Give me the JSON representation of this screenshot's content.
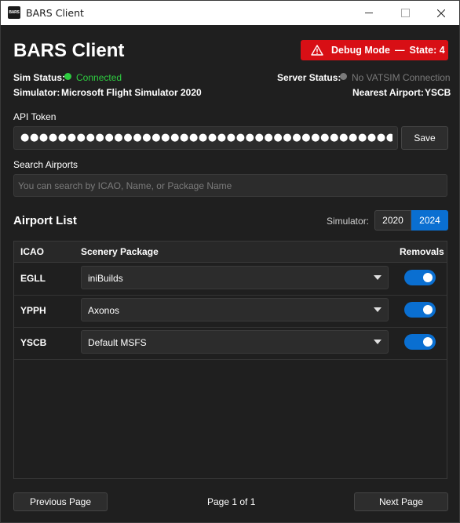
{
  "window": {
    "logo_text": "BARS",
    "title": "BARS Client"
  },
  "header": {
    "heading": "BARS Client",
    "debug": {
      "label": "Debug Mode",
      "separator": "—",
      "state": "State: 4",
      "color": "#d80f15"
    }
  },
  "status": {
    "sim_status_label": "Sim Status:",
    "sim_status_value": "Connected",
    "sim_status_color": "#2ecc40",
    "server_status_label": "Server Status:",
    "server_status_value": "No VATSIM Connection",
    "server_status_color": "#7a7a7a",
    "simulator_label": "Simulator:",
    "simulator_value": "Microsoft Flight Simulator 2020",
    "nearest_airport_label": "Nearest Airport:",
    "nearest_airport_value": "YSCB"
  },
  "api_token": {
    "label": "API Token",
    "masked_value": "●●●●●●●●●●●●●●●●●●●●●●●●●●●●●●●●●●●●●●●●●●●●●●●●●●●●●●●●●●●●●●●●●●●●●●●●●●●●●●",
    "save_label": "Save"
  },
  "search": {
    "label": "Search Airports",
    "placeholder": "You can search by ICAO, Name, or Package Name",
    "value": ""
  },
  "airport_list": {
    "title": "Airport List",
    "simulator_label": "Simulator:",
    "sim_options": [
      "2020",
      "2024"
    ],
    "selected_sim": "2024",
    "accent_color": "#0a6fd1",
    "columns": {
      "icao": "ICAO",
      "package": "Scenery Package",
      "removals": "Removals"
    },
    "rows": [
      {
        "icao": "EGLL",
        "package": "iniBuilds",
        "removals": true
      },
      {
        "icao": "YPPH",
        "package": "Axonos",
        "removals": true
      },
      {
        "icao": "YSCB",
        "package": "Default MSFS",
        "removals": true
      }
    ]
  },
  "pagination": {
    "prev_label": "Previous Page",
    "page_text": "Page 1 of 1",
    "next_label": "Next Page"
  }
}
